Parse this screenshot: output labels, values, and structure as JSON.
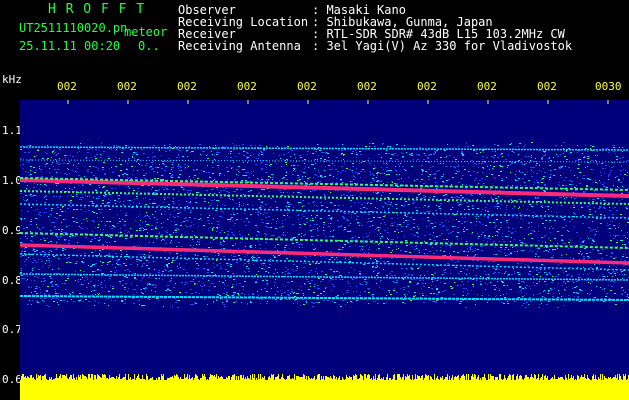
{
  "header": {
    "logo": "H R O F F T",
    "filename": "UT2511110020.pn",
    "meteor_label": "meteor",
    "datetime": "25.11.11 00:20",
    "count": "0..",
    "info_labels": [
      "Observer",
      "Receiving Location",
      "Receiver",
      "Receiving Antenna"
    ],
    "info_values": [
      ": Masaki Kano",
      ": Shibukawa, Gunma, Japan",
      ": RTL-SDR SDR# 43dB L15 103.2MHz CW",
      ": 3el Yagi(V) Az 330 for Vladivostok"
    ]
  },
  "plot": {
    "y_unit": "kHz",
    "y_ticks": [
      "1.1",
      "1.0",
      "0.9",
      "0.8",
      "0.7",
      "0.6"
    ],
    "x_ticks": [
      "002",
      "002",
      "002",
      "002",
      "002",
      "002",
      "002",
      "002",
      "002",
      "0030"
    ]
  },
  "colors": {
    "background": "#00007a",
    "noise_blue": "#1e4cff",
    "noise_cyan": "#00e0ff",
    "signal_green": "#33ff66",
    "signal_red": "#ff2a7a",
    "echo_yellow": "#ffff00",
    "text_green": "#20ff40",
    "text_white": "#ffffff",
    "text_yellow": "#ffff40"
  }
}
